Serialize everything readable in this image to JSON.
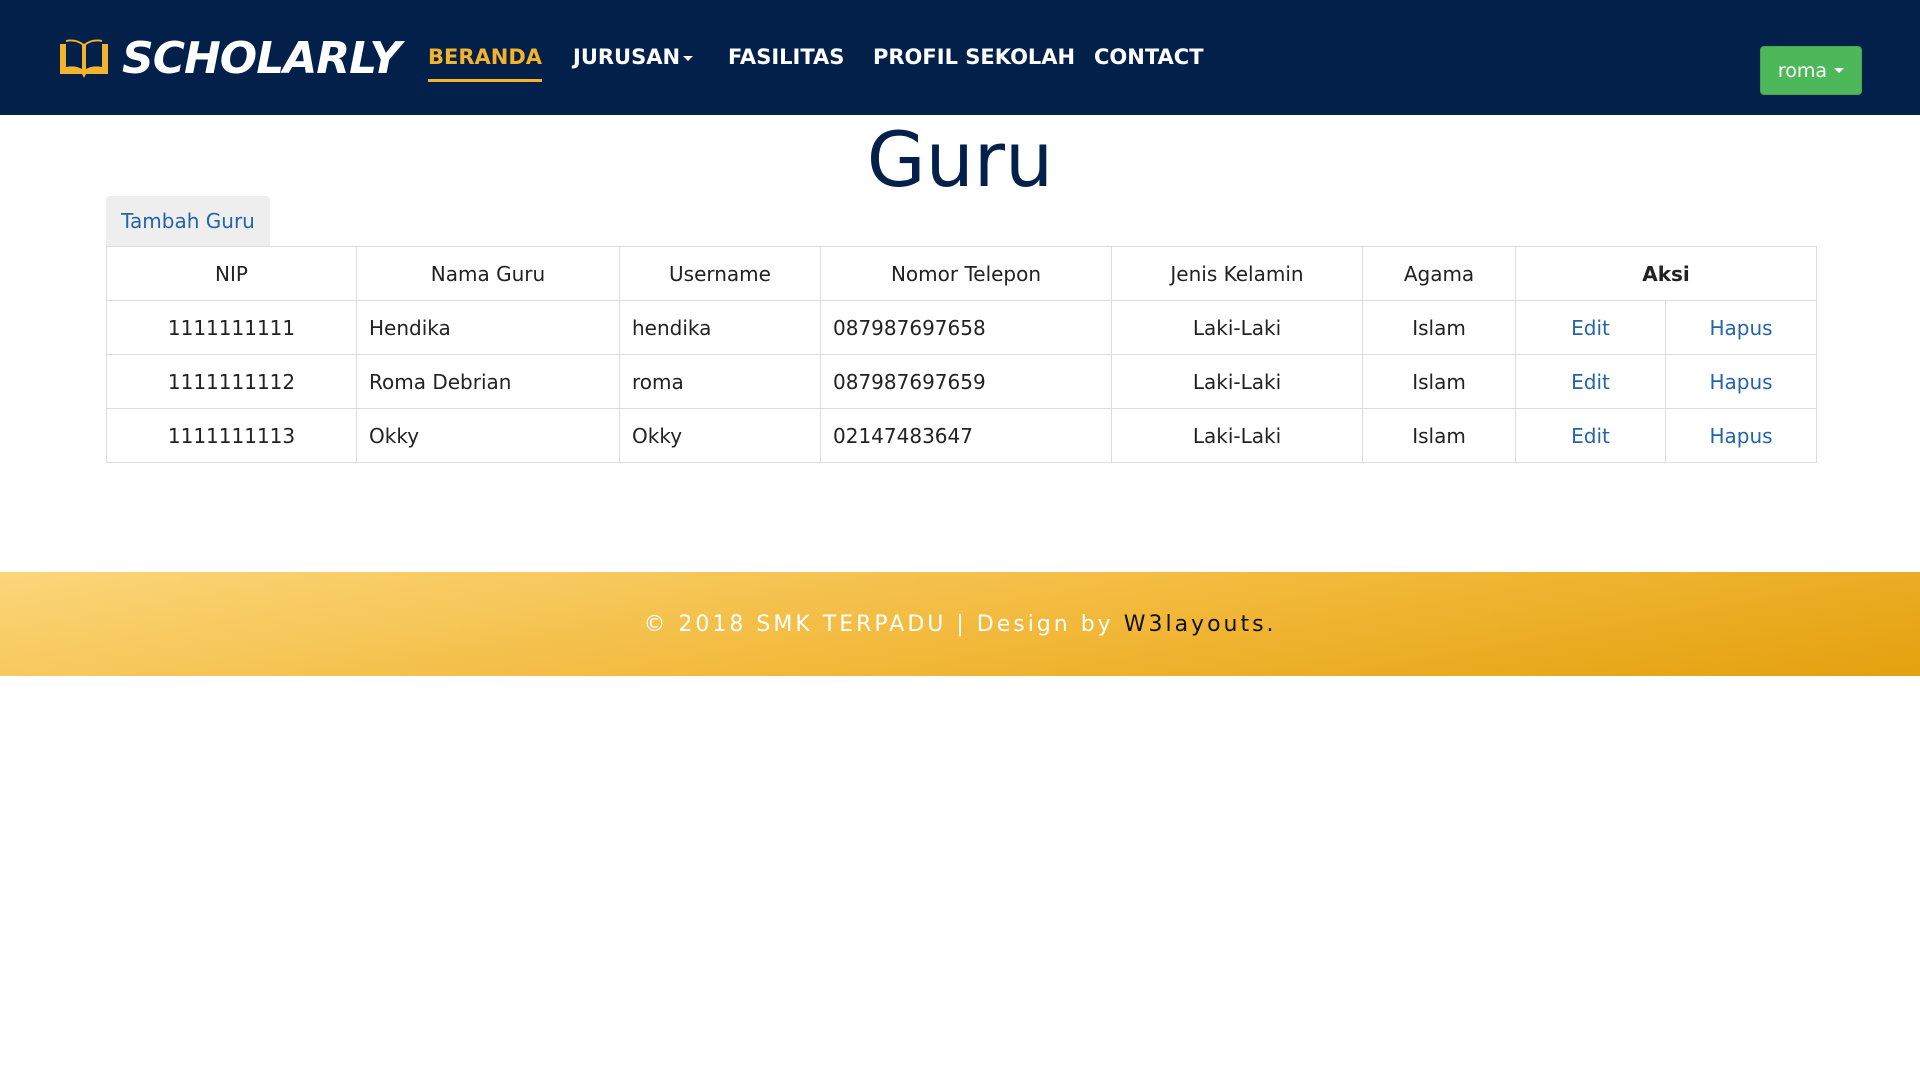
{
  "brand": {
    "name": "SCHOLARLY",
    "icon": "open-book-icon"
  },
  "nav": {
    "items": [
      {
        "label": "BERANDA",
        "active": true
      },
      {
        "label": "JURUSAN",
        "dropdown": true
      },
      {
        "label": "FASILITAS"
      },
      {
        "label": "PROFIL SEKOLAH"
      },
      {
        "label": "CONTACT"
      }
    ],
    "user": {
      "label": "roma",
      "color": "#4cb85a"
    }
  },
  "page": {
    "title": "Guru",
    "add_button": "Tambah Guru"
  },
  "table": {
    "headers": [
      "NIP",
      "Nama Guru",
      "Username",
      "Nomor Telepon",
      "Jenis Kelamin",
      "Agama",
      "Aksi"
    ],
    "rows": [
      {
        "nip": "1111111111",
        "nama": "Hendika",
        "username": "hendika",
        "telepon": "087987697658",
        "jk": "Laki-Laki",
        "agama": "Islam",
        "edit": "Edit",
        "hapus": "Hapus"
      },
      {
        "nip": "1111111112",
        "nama": "Roma Debrian",
        "username": "roma",
        "telepon": "087987697659",
        "jk": "Laki-Laki",
        "agama": "Islam",
        "edit": "Edit",
        "hapus": "Hapus"
      },
      {
        "nip": "1111111113",
        "nama": "Okky",
        "username": "Okky",
        "telepon": "02147483647",
        "jk": "Laki-Laki",
        "agama": "Islam",
        "edit": "Edit",
        "hapus": "Hapus"
      }
    ]
  },
  "footer": {
    "text": "© 2018 SMK TERPADU | Design by",
    "credit": "W3layouts."
  },
  "colors": {
    "navbar": "#02204a",
    "accent": "#f3b32d",
    "link": "#2464a8",
    "user_button": "#4cb85a"
  }
}
